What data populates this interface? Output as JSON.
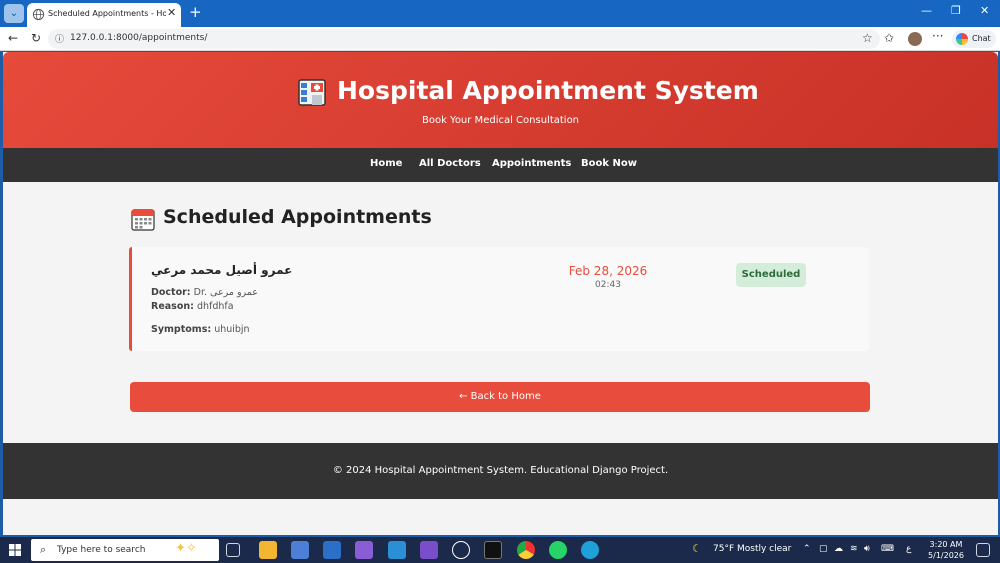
{
  "browser": {
    "tab_title": "Scheduled Appointments - Hospital",
    "url": "127.0.0.1:8000/appointments/",
    "chat_label": "Chat"
  },
  "header": {
    "title": "Hospital Appointment System",
    "subtitle": "Book Your Medical Consultation",
    "accent": "#e74c3c"
  },
  "nav": {
    "items": [
      {
        "label": "Home"
      },
      {
        "label": "All Doctors"
      },
      {
        "label": "Appointments"
      },
      {
        "label": "Book Now"
      }
    ]
  },
  "main": {
    "title": "Scheduled Appointments",
    "appointments": [
      {
        "patient": "عمرو أصيل محمد مرعي",
        "doctor_label": "Doctor:",
        "doctor": "Dr. عمرو مرعى",
        "reason_label": "Reason:",
        "reason": "dhfdhfa",
        "symptoms_label": "Symptoms:",
        "symptoms": "uhuibjn",
        "date": "Feb 28, 2026",
        "time": "02:43",
        "status": "Scheduled"
      }
    ],
    "back_button": "← Back to Home"
  },
  "footer": {
    "text": "© 2024 Hospital Appointment System. Educational Django Project."
  },
  "taskbar": {
    "search_placeholder": "Type here to search",
    "weather": "75°F  Mostly clear",
    "lang": "ع",
    "time": "3:20 AM",
    "date": "5/1/2026"
  }
}
